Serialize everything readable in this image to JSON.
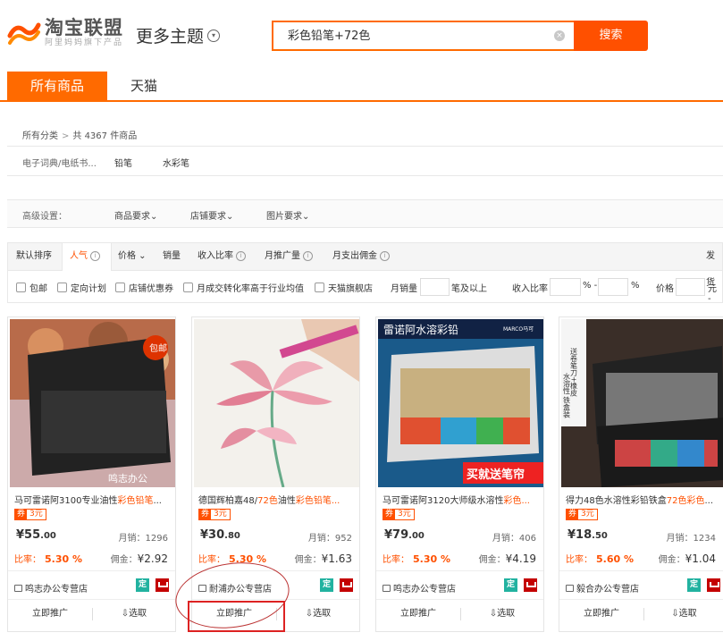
{
  "header": {
    "logo_title": "淘宝联盟",
    "logo_sub": "阿里妈妈旗下产品",
    "more_themes": "更多主题",
    "search_value": "彩色铅笔+72色",
    "search_button": "搜索"
  },
  "tabs": [
    "所有商品",
    "天猫"
  ],
  "breadcrumb": {
    "root": "所有分类",
    "count": "共 4367 件商品"
  },
  "categories": [
    "电子词典/电纸书...",
    "铅笔",
    "水彩笔"
  ],
  "advanced": {
    "label": "高级设置：",
    "items": [
      "商品要求",
      "店铺要求",
      "图片要求"
    ]
  },
  "sort": {
    "items": [
      "默认排序",
      "人气",
      "价格",
      "销量",
      "收入比率",
      "月推广量",
      "月支出佣金"
    ],
    "right": "发货"
  },
  "filters": {
    "checks": [
      "包邮",
      "定向计划",
      "店铺优惠券",
      "月成交转化率高于行业均值",
      "天猫旗舰店"
    ],
    "monthly_sales": "月销量",
    "monthly_suffix": "笔及以上",
    "income_ratio": "收入比率",
    "percent1": "% -",
    "percent2": "%",
    "price": "价格",
    "price_suffix": "元 -"
  },
  "cards": [
    {
      "title_pre": "马可雷诺阿3100专业油性",
      "title_hl": "彩色铅笔",
      "title_post": "...",
      "coupon_q": "券",
      "coupon_v": "3元",
      "price_int": "¥55",
      "price_dec": ".00",
      "sales": "月销：1296",
      "rate_label": "比率：",
      "rate": "5.30 %",
      "comm_label": "佣金：",
      "comm": "¥2.92",
      "shop": "鸣志办公专营店",
      "btn_promote": "立即推广",
      "btn_select": "⇩选取"
    },
    {
      "title_pre": "德国辉柏嘉48/",
      "title_hl": "72色",
      "title_post": "油性",
      "title_hl2": "彩色铅笔...",
      "coupon_q": "券",
      "coupon_v": "3元",
      "price_int": "¥30",
      "price_dec": ".80",
      "sales": "月销：952",
      "rate_label": "比率：",
      "rate": "5.30 %",
      "comm_label": "佣金：",
      "comm": "¥1.63",
      "shop": "耐浦办公专营店",
      "btn_promote": "立即推广",
      "btn_select": "⇩选取"
    },
    {
      "title_pre": "马可雷诺阿3120大师级水溶性",
      "title_hl": "彩色...",
      "title_post": "",
      "coupon_q": "券",
      "coupon_v": "3元",
      "price_int": "¥79",
      "price_dec": ".00",
      "sales": "月销：406",
      "rate_label": "比率：",
      "rate": "5.30 %",
      "comm_label": "佣金：",
      "comm": "¥4.19",
      "shop": "鸣志办公专营店",
      "btn_promote": "立即推广",
      "btn_select": "⇩选取"
    },
    {
      "title_pre": "得力48色水溶性彩铅铁盒",
      "title_hl": "72色彩色",
      "title_post": "...",
      "coupon_q": "券",
      "coupon_v": "3元",
      "price_int": "¥18",
      "price_dec": ".50",
      "sales": "月销：1234",
      "rate_label": "比率：",
      "rate": "5.60 %",
      "comm_label": "佣金：",
      "comm": "¥1.04",
      "shop": "毅合办公专营店",
      "btn_promote": "立即推广",
      "btn_select": "⇩选取"
    }
  ],
  "image_text": {
    "c1_badge": "包邮",
    "c1_wm": "鸣志办公",
    "c3_banner": "雷诺阿水溶彩铅",
    "c3_brand": "MARCO马可",
    "c3_promo": "买就送笔帘",
    "c4_promo": "送卷笔刀+橡皮",
    "c4_side": "水溶性 铁盒装"
  },
  "colors": {
    "accent": "#ff6a00",
    "search_btn": "#ff5000",
    "ding": "#22b2a0",
    "tmall": "#c40000"
  }
}
